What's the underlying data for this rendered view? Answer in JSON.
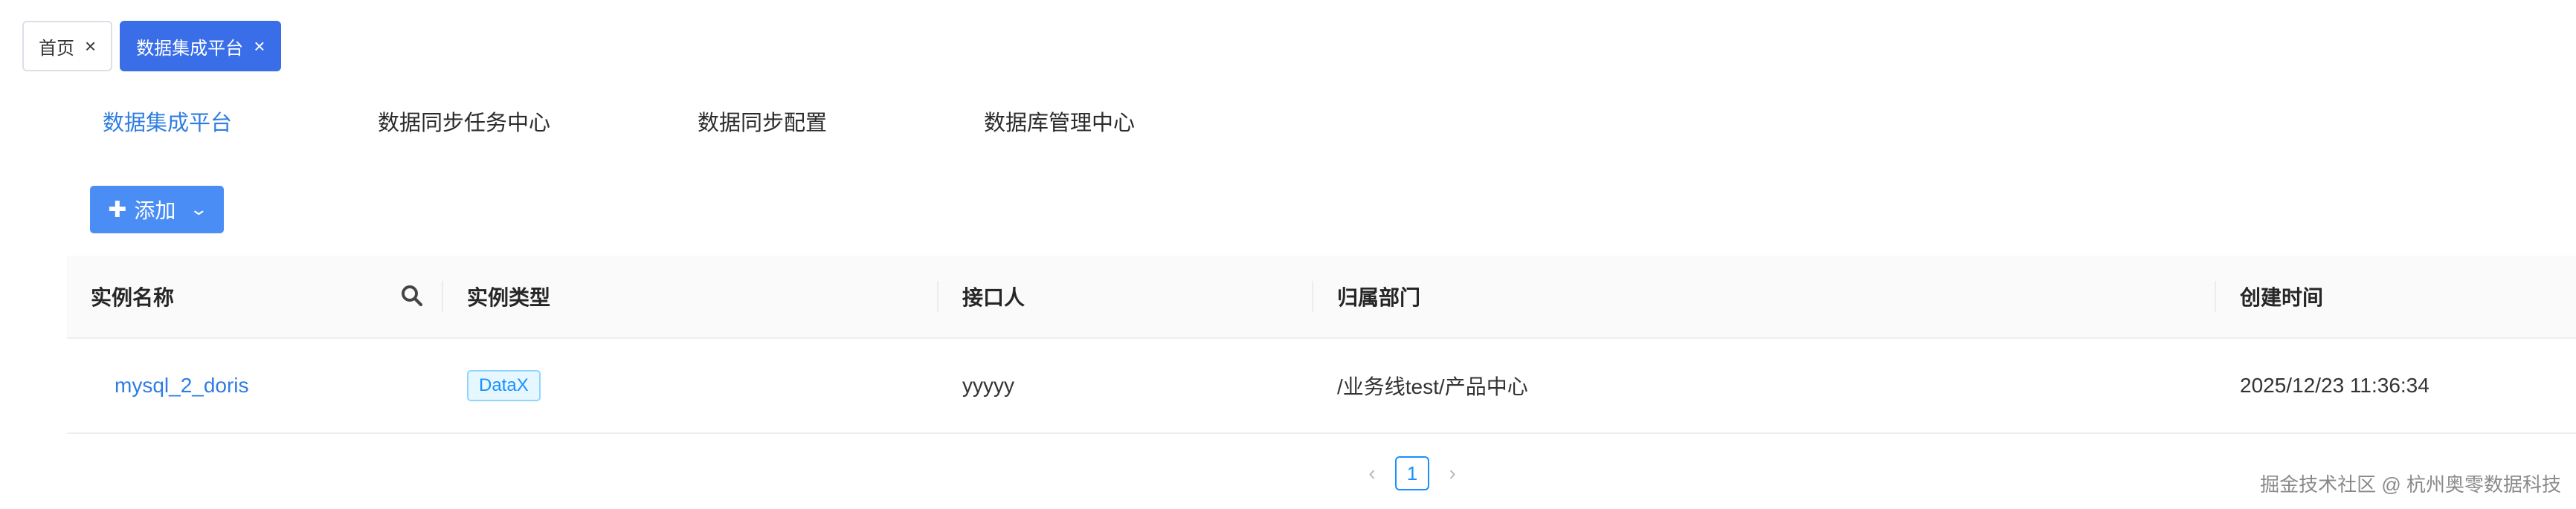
{
  "page_tabs": [
    {
      "label": "首页",
      "close": "×"
    },
    {
      "label": "数据集成平台",
      "close": "×",
      "active": true
    }
  ],
  "module_nav": {
    "items": [
      {
        "label": "数据集成平台",
        "active": true
      },
      {
        "label": "数据同步任务中心"
      },
      {
        "label": "数据同步配置"
      },
      {
        "label": "数据库管理中心"
      }
    ]
  },
  "toolbar": {
    "add_label": "添加",
    "add_icon": "plus-icon",
    "dropdown_icon": "chevron-down-icon"
  },
  "table": {
    "columns": [
      "实例名称",
      "实例类型",
      "接口人",
      "归属部门",
      "创建时间"
    ],
    "rows": [
      {
        "name": "mysql_2_doris",
        "type": "DataX",
        "contact": "yyyyy",
        "department": "/业务线test/产品中心",
        "created": "2025/12/23 11:36:34"
      }
    ]
  },
  "pagination": {
    "prev": "‹",
    "current": "1",
    "next": "›"
  },
  "watermark": "掘金技术社区 @ 杭州奥零数据科技",
  "colors": {
    "primary": "#3a6ee8",
    "link": "#2f7de1",
    "button": "#4a8ef5",
    "tag_border": "#91d5ff"
  }
}
